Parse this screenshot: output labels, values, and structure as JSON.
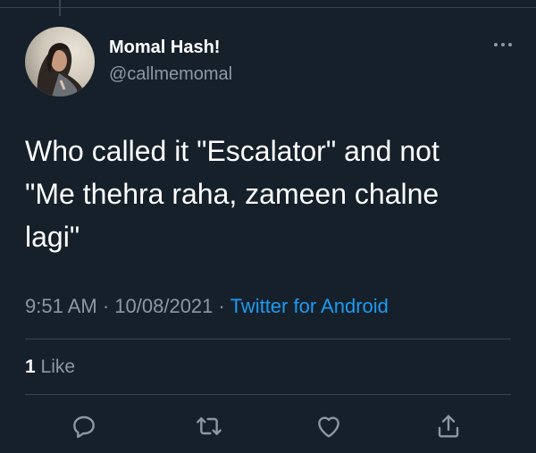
{
  "tweet": {
    "author": {
      "display_name": "Momal Hash!",
      "handle": "@callmemomal"
    },
    "text": "Who called it \"Escalator\" and not\n\"Me thehra raha, zameen chalne\nlagi\"",
    "time": "9:51 AM",
    "date": "10/08/2021",
    "source": "Twitter for Android",
    "likes": {
      "count": "1",
      "label": "Like"
    }
  },
  "icons": {
    "more": "more-horizontal-icon",
    "reply": "reply-icon",
    "retweet": "retweet-icon",
    "like": "heart-icon",
    "share": "share-icon"
  },
  "colors": {
    "background": "#15202b",
    "text": "#ffffff",
    "secondary_text": "#8b98a5",
    "link": "#1d9bf0",
    "divider": "#38444d"
  }
}
